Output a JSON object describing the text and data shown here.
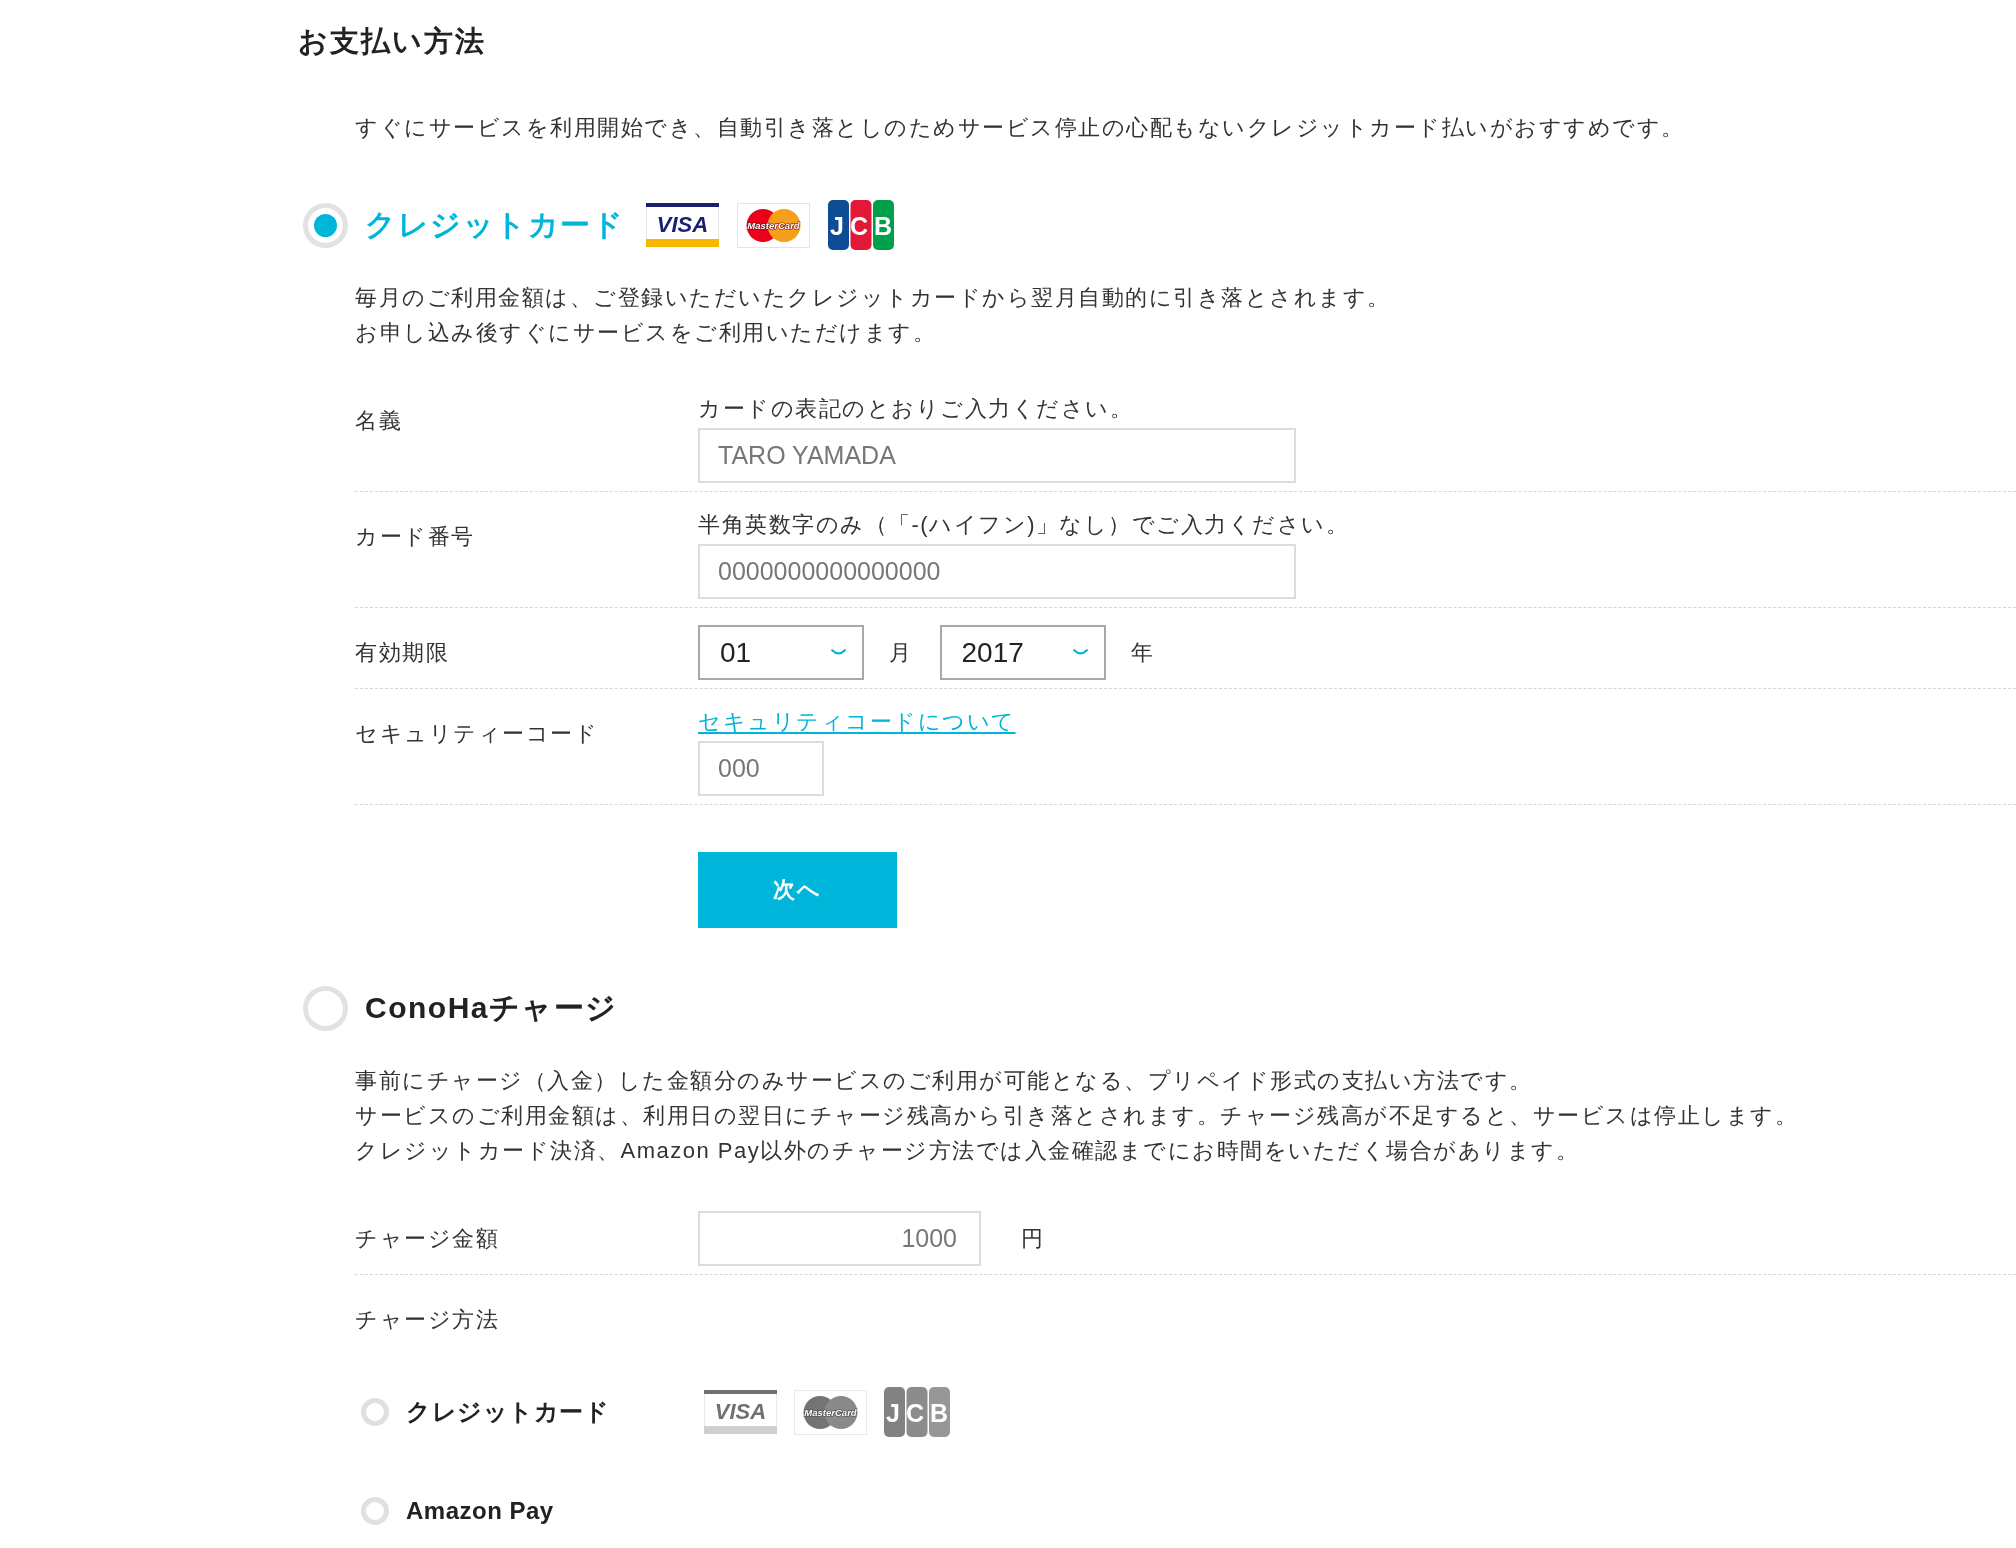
{
  "title": "お支払い方法",
  "intro": "すぐにサービスを利用開始でき、自動引き落としのためサービス停止の心配もないクレジットカード払いがおすすめです。",
  "methods": [
    {
      "kind": "card",
      "label": "クレジットカード",
      "selected": true,
      "cards": [
        {
          "kind": "visa",
          "label": "VISA",
          "disabled": false
        },
        {
          "kind": "mastercard",
          "label": "MasterCard",
          "disabled": false
        },
        {
          "kind": "jcb",
          "label": "JCB",
          "disabled": false
        }
      ],
      "description": [
        "毎月のご利用金額は、ご登録いただいたクレジットカードから翌月自動的に引き落とされます。",
        "お申し込み後すぐにサービスをご利用いただけます。"
      ],
      "fields": [
        {
          "label": "名義",
          "hint": "カードの表記のとおりご入力ください。",
          "inputs": [
            {
              "kind": "text",
              "placeholder": "TARO YAMADA"
            }
          ]
        },
        {
          "label": "カード番号",
          "hint": "半角英数字のみ（「-(ハイフン)」なし）でご入力ください。",
          "inputs": [
            {
              "kind": "text",
              "placeholder": "0000000000000000"
            }
          ]
        },
        {
          "label": "有効期限",
          "inputs": [
            {
              "kind": "select",
              "value": "01",
              "unit": "月"
            },
            {
              "kind": "select",
              "value": "2017",
              "unit": "年"
            }
          ]
        },
        {
          "label": "セキュリティーコード",
          "link": "セキュリティコードについて",
          "inputs": [
            {
              "kind": "code",
              "placeholder": "000"
            }
          ]
        }
      ],
      "submit": "次へ"
    },
    {
      "kind": "charge",
      "label": "ConoHaチャージ",
      "selected": false,
      "description": [
        "事前にチャージ（入金）した金額分のみサービスのご利用が可能となる、プリペイド形式の支払い方法です。",
        "サービスのご利用金額は、利用日の翌日にチャージ残高から引き落とされます。チャージ残高が不足すると、サービスは停止します。",
        "クレジットカード決済、Amazon Pay以外のチャージ方法では入金確認までにお時間をいただく場合があります。"
      ],
      "fields": [
        {
          "label": "チャージ金額",
          "inputs": [
            {
              "kind": "amount",
              "placeholder": "1000",
              "unit": "円"
            }
          ]
        }
      ],
      "charge_method": {
        "label": "チャージ方法",
        "options": [
          {
            "label": "クレジットカード",
            "selected": false,
            "cards": [
              {
                "kind": "visa",
                "label": "VISA",
                "disabled": true
              },
              {
                "kind": "mastercard",
                "label": "MasterCard",
                "disabled": true
              },
              {
                "kind": "jcb",
                "label": "JCB",
                "disabled": true
              }
            ]
          },
          {
            "label": "Amazon Pay",
            "selected": false
          }
        ]
      }
    }
  ]
}
